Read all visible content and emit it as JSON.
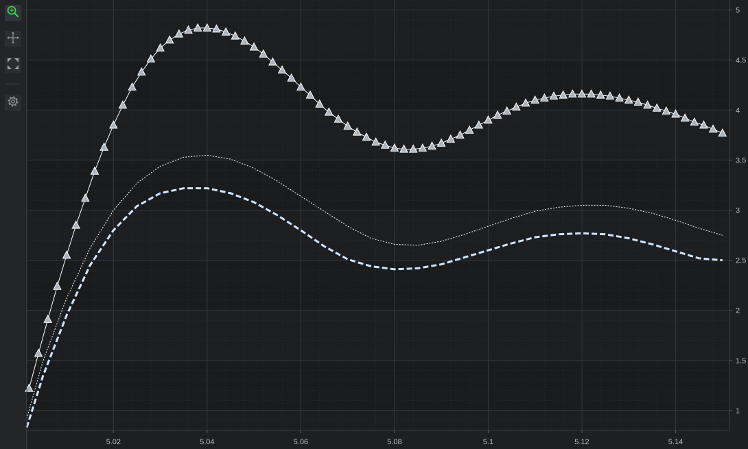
{
  "toolbar": {
    "items": [
      {
        "name": "zoom-icon",
        "active": true
      },
      {
        "name": "pan-icon",
        "active": false
      },
      {
        "name": "zoom-extents-icon",
        "active": false
      },
      {
        "name": "settings-icon",
        "active": false
      }
    ]
  },
  "colors": {
    "background": "#1e1f22",
    "plot_band_a": "#1d1e21",
    "plot_band_b": "#1a1b1d",
    "grid_major": "#34373c",
    "grid_minor": "#2a2c30",
    "series_markers": "#ffffff",
    "series_dotted": "#ffffff",
    "series_dashed": "#cfe6ff",
    "marker_fill": "#a9b3bf",
    "zoom_active": "#3ecf4f"
  },
  "chart_data": {
    "type": "line",
    "title": "",
    "xlabel": "",
    "ylabel": "",
    "xlim": [
      5.0015,
      5.1515
    ],
    "ylim": [
      0.8,
      5.1
    ],
    "x_ticks": [
      "5.02",
      "5.04",
      "5.06",
      "5.08",
      "5.1",
      "5.12",
      "5.14"
    ],
    "x_tick_values": [
      5.02,
      5.04,
      5.06,
      5.08,
      5.1,
      5.12,
      5.14
    ],
    "y_ticks": [
      "1",
      "1.5",
      "2",
      "2.5",
      "3",
      "3.5",
      "4",
      "4.5",
      "5"
    ],
    "y_tick_values": [
      1,
      1.5,
      2,
      2.5,
      3,
      3.5,
      4,
      4.5,
      5
    ],
    "y_axis_side": "right",
    "grid": true,
    "legend": "none",
    "series": [
      {
        "style": "solid-triangle-markers",
        "x": [
          5.002,
          5.004,
          5.006,
          5.008,
          5.01,
          5.012,
          5.014,
          5.016,
          5.018,
          5.02,
          5.022,
          5.024,
          5.026,
          5.028,
          5.03,
          5.032,
          5.034,
          5.036,
          5.038,
          5.04,
          5.042,
          5.044,
          5.046,
          5.048,
          5.05,
          5.052,
          5.054,
          5.056,
          5.058,
          5.06,
          5.062,
          5.064,
          5.066,
          5.068,
          5.07,
          5.072,
          5.074,
          5.076,
          5.078,
          5.08,
          5.082,
          5.084,
          5.086,
          5.088,
          5.09,
          5.092,
          5.094,
          5.096,
          5.098,
          5.1,
          5.102,
          5.104,
          5.106,
          5.108,
          5.11,
          5.112,
          5.114,
          5.116,
          5.118,
          5.12,
          5.122,
          5.124,
          5.126,
          5.128,
          5.13,
          5.132,
          5.134,
          5.136,
          5.138,
          5.14,
          5.142,
          5.144,
          5.146,
          5.148,
          5.15
        ],
        "y": [
          1.22,
          1.57,
          1.91,
          2.24,
          2.55,
          2.85,
          3.12,
          3.39,
          3.63,
          3.85,
          4.05,
          4.23,
          4.38,
          4.51,
          4.62,
          4.7,
          4.76,
          4.8,
          4.82,
          4.82,
          4.81,
          4.78,
          4.74,
          4.69,
          4.63,
          4.56,
          4.48,
          4.4,
          4.32,
          4.23,
          4.15,
          4.06,
          3.98,
          3.91,
          3.84,
          3.78,
          3.73,
          3.68,
          3.65,
          3.62,
          3.61,
          3.61,
          3.62,
          3.64,
          3.67,
          3.71,
          3.75,
          3.8,
          3.85,
          3.9,
          3.95,
          3.99,
          4.03,
          4.07,
          4.1,
          4.12,
          4.14,
          4.15,
          4.16,
          4.16,
          4.16,
          4.15,
          4.14,
          4.12,
          4.1,
          4.08,
          4.05,
          4.02,
          3.99,
          3.96,
          3.92,
          3.88,
          3.85,
          3.81,
          3.77
        ]
      },
      {
        "style": "dotted",
        "x": [
          5.0015,
          5.005,
          5.01,
          5.015,
          5.02,
          5.025,
          5.03,
          5.035,
          5.04,
          5.045,
          5.05,
          5.055,
          5.06,
          5.065,
          5.07,
          5.075,
          5.08,
          5.085,
          5.09,
          5.095,
          5.1,
          5.105,
          5.11,
          5.115,
          5.12,
          5.125,
          5.13,
          5.135,
          5.14,
          5.145,
          5.15
        ],
        "y": [
          0.92,
          1.5,
          2.12,
          2.62,
          3.0,
          3.27,
          3.44,
          3.53,
          3.55,
          3.51,
          3.42,
          3.29,
          3.14,
          2.99,
          2.84,
          2.72,
          2.66,
          2.65,
          2.69,
          2.76,
          2.84,
          2.92,
          2.99,
          3.03,
          3.05,
          3.05,
          3.02,
          2.97,
          2.9,
          2.82,
          2.75
        ]
      },
      {
        "style": "dashed",
        "x": [
          5.0015,
          5.005,
          5.01,
          5.015,
          5.02,
          5.025,
          5.03,
          5.035,
          5.04,
          5.045,
          5.05,
          5.055,
          5.06,
          5.065,
          5.07,
          5.075,
          5.08,
          5.085,
          5.09,
          5.095,
          5.1,
          5.105,
          5.11,
          5.115,
          5.12,
          5.125,
          5.13,
          5.135,
          5.14,
          5.145,
          5.15
        ],
        "y": [
          0.83,
          1.35,
          1.95,
          2.45,
          2.8,
          3.04,
          3.17,
          3.22,
          3.22,
          3.17,
          3.08,
          2.95,
          2.8,
          2.64,
          2.51,
          2.44,
          2.41,
          2.42,
          2.46,
          2.53,
          2.6,
          2.67,
          2.73,
          2.76,
          2.77,
          2.76,
          2.72,
          2.66,
          2.59,
          2.52,
          2.5
        ]
      }
    ]
  }
}
